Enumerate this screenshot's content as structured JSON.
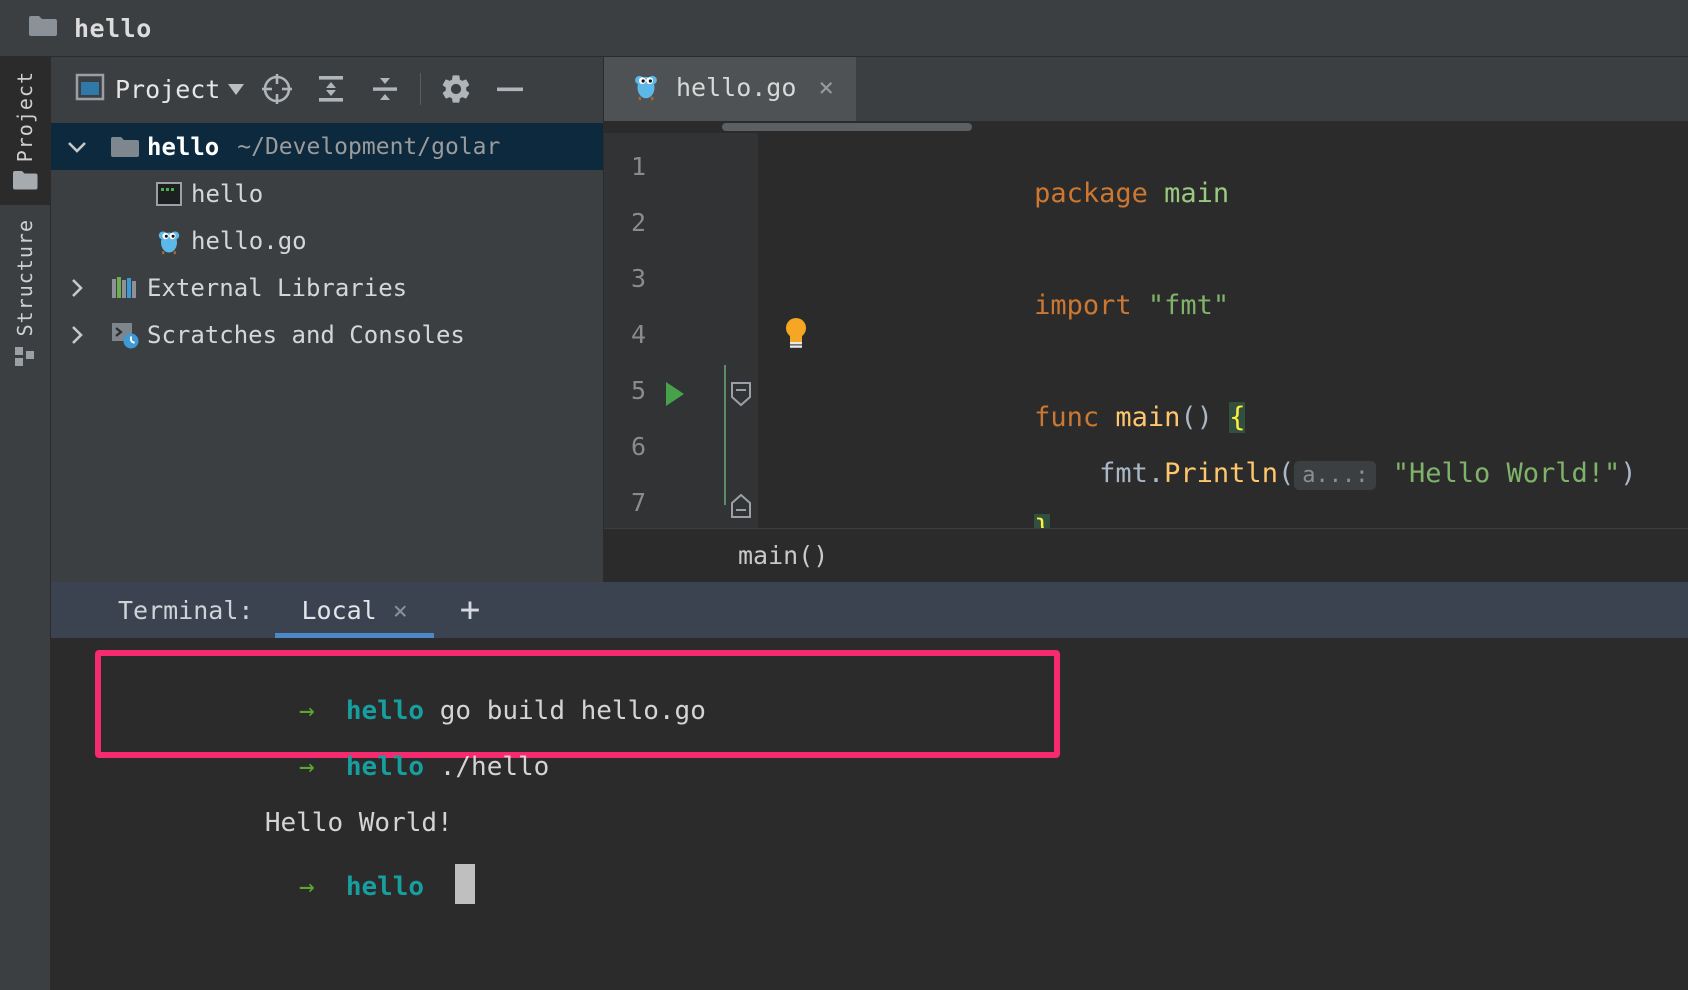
{
  "window": {
    "title": "hello",
    "folder_icon": "folder-icon"
  },
  "tool_stripe": {
    "items": [
      {
        "label": "Project",
        "icon": "folder-icon",
        "active": true
      },
      {
        "label": "Structure",
        "icon": "structure-grid-icon",
        "active": false
      }
    ]
  },
  "project_panel": {
    "toolbar": {
      "view_selector": "Project",
      "caret": "chevron-down-icon",
      "buttons": [
        {
          "name": "select-opened-file-icon",
          "tooltip": "Select Opened File"
        },
        {
          "name": "expand-all-icon",
          "tooltip": "Expand All"
        },
        {
          "name": "collapse-all-icon",
          "tooltip": "Collapse All"
        },
        {
          "name": "gear-icon",
          "tooltip": "Settings"
        },
        {
          "name": "hide-icon",
          "tooltip": "Hide"
        }
      ]
    },
    "tree": [
      {
        "label": "hello",
        "path": "~/Development/golar",
        "icon": "folder-icon",
        "expanded": true,
        "selected": true,
        "twisty": "chevron-down-icon",
        "bold": true,
        "indent": 0
      },
      {
        "label": "hello",
        "path": "",
        "icon": "binary-file-icon",
        "expanded": false,
        "selected": false,
        "twisty": "",
        "bold": false,
        "indent": 2
      },
      {
        "label": "hello.go",
        "path": "",
        "icon": "go-file-icon",
        "expanded": false,
        "selected": false,
        "twisty": "",
        "bold": false,
        "indent": 2
      },
      {
        "label": "External Libraries",
        "path": "",
        "icon": "libraries-icon",
        "expanded": false,
        "selected": false,
        "twisty": "chevron-right-icon",
        "bold": false,
        "indent": 0
      },
      {
        "label": "Scratches and Consoles",
        "path": "",
        "icon": "scratches-console-icon",
        "expanded": false,
        "selected": false,
        "twisty": "chevron-right-icon",
        "bold": false,
        "indent": 0
      }
    ]
  },
  "editor": {
    "tabs": [
      {
        "label": "hello.go",
        "icon": "go-file-icon",
        "close": "×",
        "active": true
      }
    ],
    "lines": [
      {
        "number": "1",
        "segments": [
          {
            "t": "package ",
            "c": "kw"
          },
          {
            "t": "main",
            "c": "pkg"
          }
        ]
      },
      {
        "number": "2",
        "segments": []
      },
      {
        "number": "3",
        "segments": [
          {
            "t": "import ",
            "c": "kw"
          },
          {
            "t": "\"fmt\"",
            "c": "str"
          }
        ]
      },
      {
        "number": "4",
        "segments": []
      },
      {
        "number": "5",
        "segments": [
          {
            "t": "func ",
            "c": "kw"
          },
          {
            "t": "main",
            "c": "fn"
          },
          {
            "t": "()",
            "c": "paren"
          },
          {
            "t": " ",
            "c": "ident"
          },
          {
            "t": "{",
            "c": "brace-y brace-hl"
          }
        ]
      },
      {
        "number": "6",
        "segments": [
          {
            "t": "    fmt",
            "c": "ident"
          },
          {
            "t": ".",
            "c": "ident"
          },
          {
            "t": "Println",
            "c": "fn"
          },
          {
            "t": "(",
            "c": "paren"
          },
          {
            "t": "a...:",
            "c": "hint"
          },
          {
            "t": " \"Hello World!\"",
            "c": "str"
          },
          {
            "t": ")",
            "c": "paren"
          }
        ]
      },
      {
        "number": "7",
        "segments": [
          {
            "t": "}",
            "c": "brace-y brace-hl"
          }
        ]
      }
    ],
    "gutter": {
      "run_marker_line": "5",
      "run_marker_icon": "run-triangle-icon",
      "fold_open_line": "5",
      "fold_close_line": "7"
    },
    "intention_bulb": {
      "icon": "lightbulb-icon",
      "line": "4"
    },
    "breadcrumb": "main()"
  },
  "terminal": {
    "title": "Terminal:",
    "tabs": [
      {
        "label": "Local",
        "close": "×",
        "active": true
      }
    ],
    "add_button": "+",
    "lines": [
      {
        "prompt": "→",
        "cwd": "hello",
        "text": " go build hello.go",
        "output": false
      },
      {
        "prompt": "→",
        "cwd": "hello",
        "text": " ./hello",
        "output": false
      },
      {
        "prompt": "",
        "cwd": "",
        "text": "Hello World!",
        "output": true
      },
      {
        "prompt": "→",
        "cwd": "hello",
        "text": "",
        "output": false,
        "cursor": true
      }
    ],
    "highlight": {
      "color": "#f62a6f",
      "covers_lines": [
        0,
        1
      ]
    }
  },
  "colors": {
    "accent_pink": "#f62a6f",
    "prompt_green": "#5aa832",
    "cwd_teal": "#179e9e",
    "keyword_orange": "#cc7832",
    "string_green": "#7fb36a",
    "function_yellow": "#ffc66d",
    "tab_underline_blue": "#4a88c7",
    "selection_navy": "#0d293e"
  }
}
